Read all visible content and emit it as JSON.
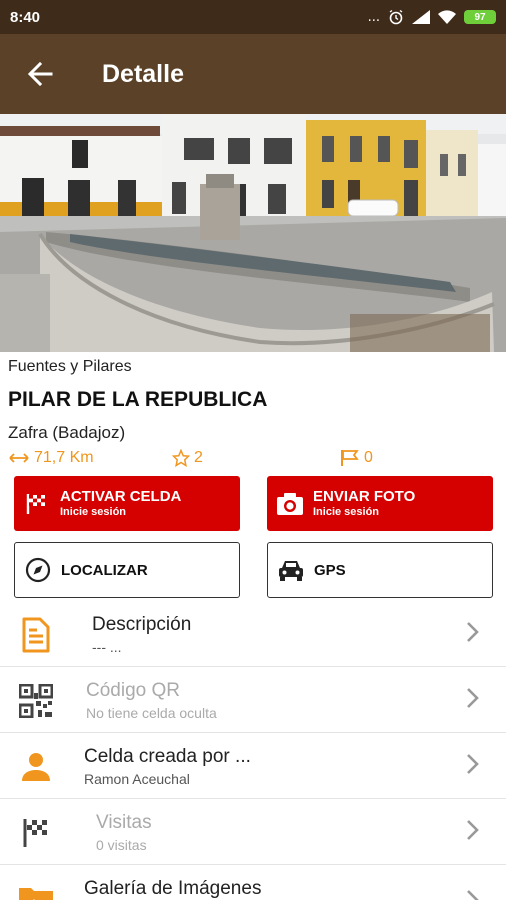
{
  "status_bar": {
    "time": "8:40",
    "dots": "...",
    "battery": "97"
  },
  "app_bar": {
    "title": "Detalle"
  },
  "place": {
    "category": "Fuentes y Pilares",
    "name": "PILAR DE LA REPUBLICA",
    "location": "Zafra (Badajoz)",
    "distance": "71,7 Km",
    "stars": "2",
    "flags": "0"
  },
  "actions": {
    "activate": {
      "label": "ACTIVAR CELDA",
      "sub": "Inicie sesión"
    },
    "send_photo": {
      "label": "ENVIAR FOTO",
      "sub": "Inicie sesión"
    },
    "locate": {
      "label": "LOCALIZAR"
    },
    "gps": {
      "label": "GPS"
    }
  },
  "list": [
    {
      "title": "Descripción",
      "subtitle": "--- ...",
      "enabled": true
    },
    {
      "title": "Código QR",
      "subtitle": "No tiene celda oculta",
      "enabled": false
    },
    {
      "title": "Celda creada por ...",
      "subtitle": "Ramon Aceuchal",
      "enabled": true
    },
    {
      "title": "Visitas",
      "subtitle": "0 visitas",
      "enabled": false
    },
    {
      "title": "Galería de Imágenes",
      "subtitle": "",
      "enabled": true
    }
  ],
  "colors": {
    "accent": "#f0961e",
    "primary": "#5a4128",
    "statusbar": "#3e2b19",
    "action_red": "#d50000"
  },
  "icons": {
    "back": "arrow-left-icon",
    "distance": "arrows-horizontal-icon",
    "star": "star-icon",
    "flag": "flag-icon",
    "activate": "checkered-flag-icon",
    "camera": "camera-icon",
    "compass": "compass-icon",
    "car": "car-icon",
    "description": "document-icon",
    "qr": "qr-code-icon",
    "person": "person-icon",
    "visits": "checkered-flag-icon",
    "gallery": "folder-image-icon"
  }
}
